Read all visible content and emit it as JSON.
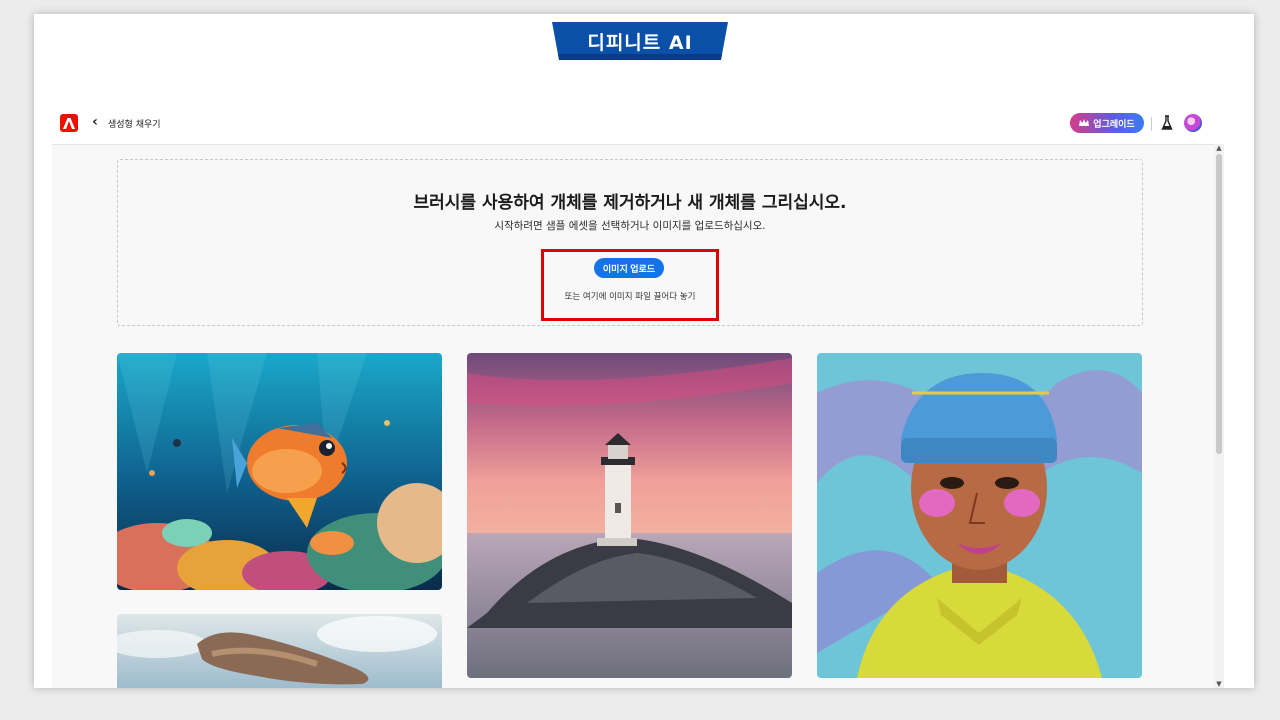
{
  "banner": {
    "title": "디피니트 AI"
  },
  "topbar": {
    "back_icon": "chevron-left-icon",
    "breadcrumb": "생성형 채우기",
    "upgrade_label": "업그레이드",
    "upgrade_icon": "crown-icon",
    "labs_icon": "flask-icon",
    "avatar_icon": "avatar"
  },
  "dropzone": {
    "title": "브러시를 사용하여 개체를 제거하거나 새 개체를 그리십시오.",
    "subtitle": "시작하려면 샘플 에셋을 선택하거나 이미지를 업로드하십시오.",
    "upload_label": "이미지 업로드",
    "drag_text": "또는 여기에 이미지 파일 끌어다 놓기"
  },
  "samples": [
    {
      "name": "sample-underwater-fish"
    },
    {
      "name": "sample-lighthouse"
    },
    {
      "name": "sample-portrait-beanie"
    },
    {
      "name": "sample-sky-shape"
    }
  ],
  "colors": {
    "banner": "#0a4fa8",
    "adobe_red": "#eb1000",
    "upload_blue": "#1473e6",
    "highlight_red": "#e00000"
  }
}
